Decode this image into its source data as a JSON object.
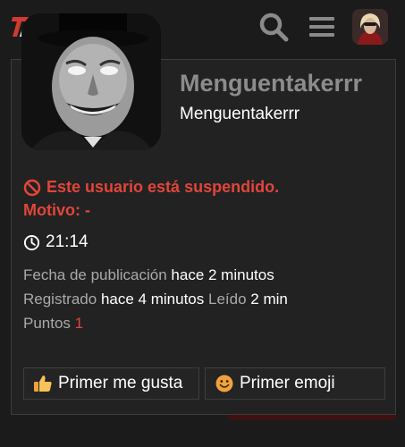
{
  "topbar": {
    "logo_icon": "tr-logo-icon",
    "search_icon": "search-icon",
    "menu_icon": "hamburger-menu-icon",
    "avatar": "user-avatar"
  },
  "profile": {
    "display_name": "Menguentakerrr",
    "username": "Menguentakerrr"
  },
  "status": {
    "suspended_text": "Este usuario está suspendido.",
    "reason_text": "Motivo: -"
  },
  "post": {
    "time": "21:14",
    "published_label": "Fecha de publicación",
    "published_value": "hace 2 minutos",
    "registered_label": "Registrado",
    "registered_value": "hace 4 minutos",
    "read_label": "Leído",
    "read_value": "2 min",
    "points_label": "Puntos",
    "points_value": "1"
  },
  "actions": {
    "first_like": "Primer me gusta",
    "first_emoji": "Primer emoji"
  },
  "colors": {
    "accent_red": "#e2453a",
    "background": "#1b1b1b",
    "card": "#222222"
  }
}
